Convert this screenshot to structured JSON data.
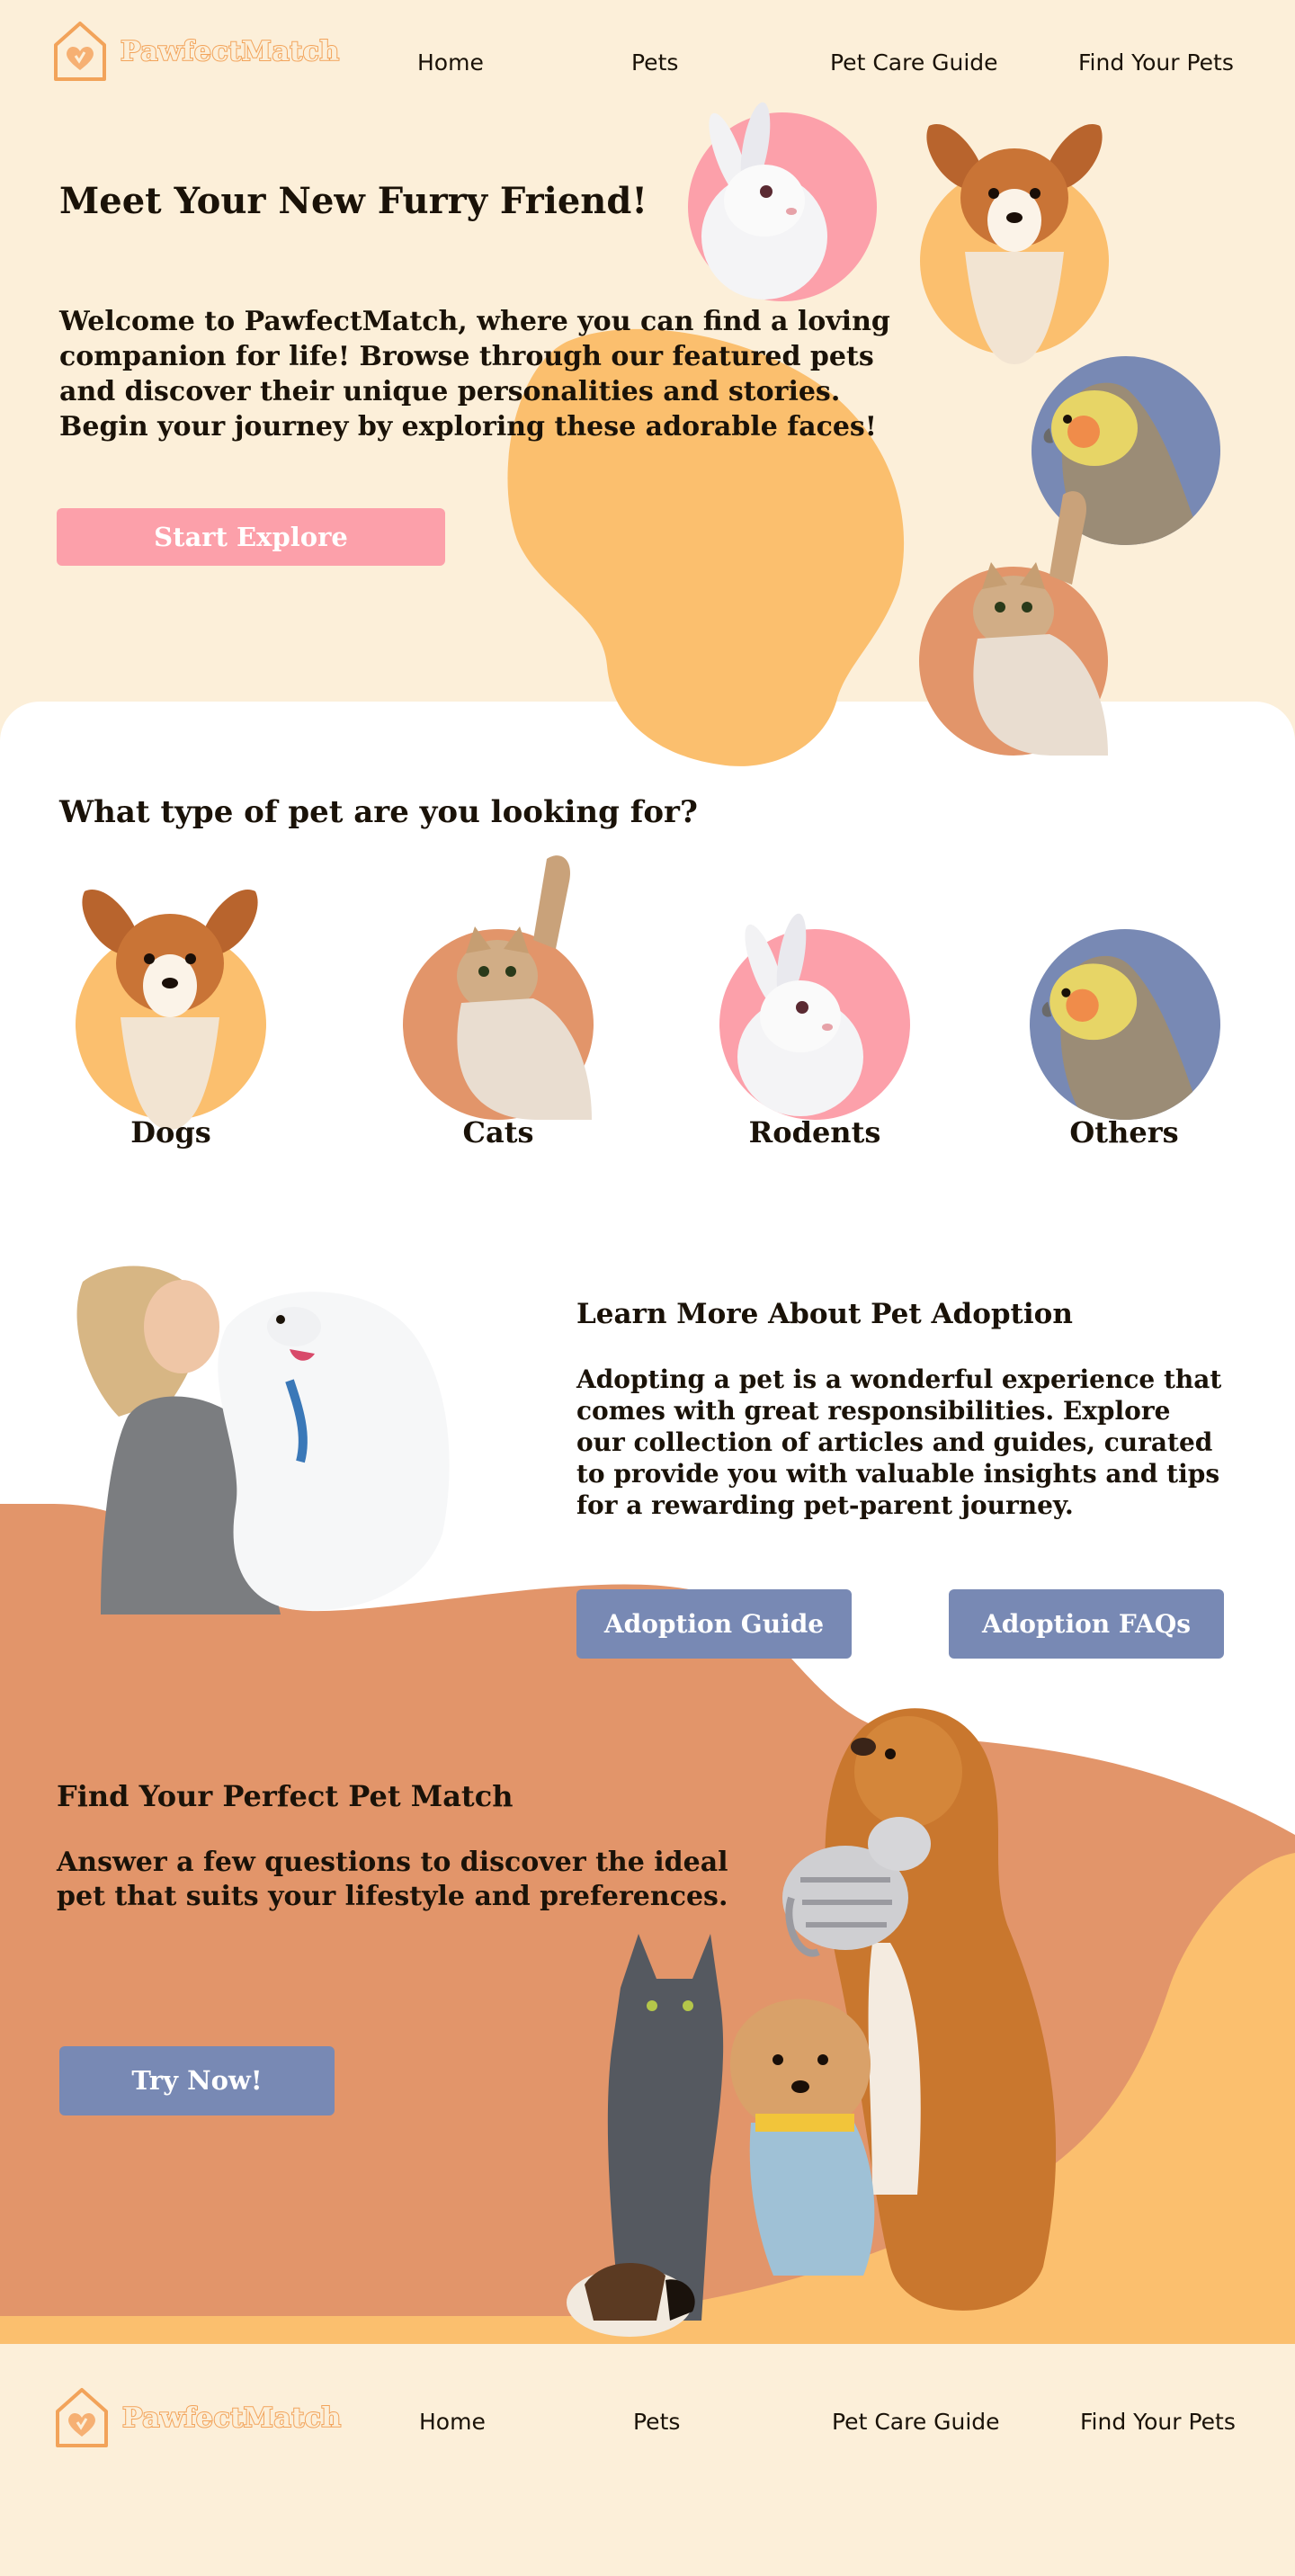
{
  "brand": {
    "name": "PawfectMatch"
  },
  "nav": {
    "links": [
      "Home",
      "Pets",
      "Pet Care Guide",
      "Find Your Pets"
    ]
  },
  "hero": {
    "title": "Meet Your New Furry Friend!",
    "text": "Welcome to PawfectMatch, where you can find a loving companion for life! Browse through our featured pets and discover their unique personalities and stories. Begin your journey by exploring these adorable faces!",
    "cta": "Start Explore"
  },
  "pet_types": {
    "title": "What type of pet are you looking for?",
    "items": [
      {
        "label": "Dogs",
        "icon": "dog-icon"
      },
      {
        "label": "Cats",
        "icon": "cat-icon"
      },
      {
        "label": "Rodents",
        "icon": "rabbit-icon"
      },
      {
        "label": "Others",
        "icon": "bird-icon"
      }
    ]
  },
  "learn": {
    "title": "Learn More About Pet Adoption",
    "text": "Adopting a pet is a wonderful experience that comes with great responsibilities. Explore our collection of articles and guides, curated to provide you with valuable insights and tips for a rewarding pet-parent journey.",
    "guide_button": "Adoption Guide",
    "faq_button": "Adoption FAQs"
  },
  "match": {
    "title": "Find Your Perfect Pet Match",
    "text": "Answer a few questions to discover the ideal pet that suits your lifestyle and preferences.",
    "cta": "Try Now!"
  },
  "colors": {
    "cream": "#fcefd9",
    "orange": "#fbbf6e",
    "terracotta": "#e2956a",
    "pink": "#fca0aa",
    "blue": "#7889b4",
    "white": "#ffffff"
  }
}
